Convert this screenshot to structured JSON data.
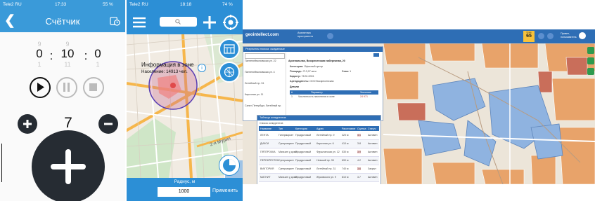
{
  "counter_app": {
    "status": {
      "carrier": "Tele2 RU",
      "time": "17:33",
      "battery": "55 %"
    },
    "title": "Счётчик",
    "icons": {
      "back": "back-chevron-icon",
      "timer": "timer-icon"
    },
    "time_digits": [
      {
        "above": "9",
        "value": "0",
        "below": "1"
      },
      {
        "above": "9",
        "value": "10",
        "below": "11"
      },
      {
        "above": "",
        "value": "0",
        "below": "1"
      }
    ],
    "time_separator": ":",
    "count": "7",
    "controls": [
      "play",
      "pause",
      "stop"
    ],
    "colors": {
      "header": "#3a9ad9",
      "dark": "#262c33"
    }
  },
  "map_app": {
    "status": {
      "carrier": "Tele2 RU",
      "time": "18:18",
      "battery": "74 %"
    },
    "search_placeholder": "",
    "info_popup": {
      "title": "Информация в зоне",
      "population_label": "Население:",
      "population_value": "14913 чел."
    },
    "street_label": "2-я Мурин",
    "radius_label": "Радиус, м",
    "radius_value": "1000",
    "apply_button": "Применить",
    "colors": {
      "header": "#2c8fd6",
      "zone": "#5a3fb3",
      "highlight": "#f08a8a"
    }
  },
  "web_app": {
    "logo": "geointellect.com",
    "menu_item": "Аналитика\nпространств",
    "score_label": "Очки",
    "score_value": "65",
    "user_label": "Привет,\nпользователь",
    "panel_title": "Результаты поиска: ожидаемые",
    "results": [
      "Пантелеймоновская ул. 22",
      "Пантелеймоновская ул. 4",
      "Литейный пр. 51",
      "Кирочная ул. 11",
      "Санкт-Петербург, Литейный пр."
    ],
    "detail": {
      "address": "Арсенальная, Воскресенская набережная, 20",
      "category_label": "Категория:",
      "category_value": "Офисный центр",
      "area_label": "Площадь:",
      "area_value": "713,07 кв.м",
      "floor_label": "Этаж:",
      "floor_value": "1",
      "tax_label": "Кадастр:",
      "tax_value": "78:31:0001",
      "owner_label": "Арендодатель:",
      "owner_value": "ООО Воскресенская",
      "section_title": "Детали",
      "table_header": [
        "#",
        "Параметр",
        "Значение"
      ],
      "table_row": [
        "1",
        "Численность населения в зоне",
        "24 971"
      ]
    },
    "build_panel": {
      "title": "Таблица конкурентов",
      "subtitle": "Список конкурентов",
      "columns": [
        "Название",
        "Тип",
        "Категория",
        "Адрес",
        "Расстояние",
        "Оценка",
        "Статус"
      ],
      "rows": [
        [
          "ЛЕНТА",
          "Гипермаркет",
          "Продуктовый",
          "Литейный пр. 9",
          "320 м",
          "4.1",
          "Активен"
        ],
        [
          "ДИКСИ",
          "Супермаркет",
          "Продуктовый",
          "Кирочная ул. 6",
          "410 м",
          "3.8",
          "Активен"
        ],
        [
          "ПЯТЁРОЧКА",
          "Магазин у дома",
          "Продуктовый",
          "Фурштатская ул. 12",
          "530 м",
          "3.9",
          "Активен"
        ],
        [
          "ПЕРЕКРЁСТОК",
          "Супермаркет",
          "Продуктовый",
          "Невский пр. 35",
          "690 м",
          "4.2",
          "Активен"
        ],
        [
          "ВИКТОРИЯ",
          "Супермаркет",
          "Продуктовый",
          "Литейный пр. 31",
          "740 м",
          "3.6",
          "Закрыт"
        ],
        [
          "МАГНИТ",
          "Магазин у дома",
          "Продуктовый",
          "Жуковского ул. 9",
          "810 м",
          "3.7",
          "Активен"
        ]
      ]
    },
    "colors": {
      "header": "#2e6eb5",
      "building": "#e8a36a",
      "selection": "#8fb3e0",
      "score": "#f7c23a"
    }
  }
}
